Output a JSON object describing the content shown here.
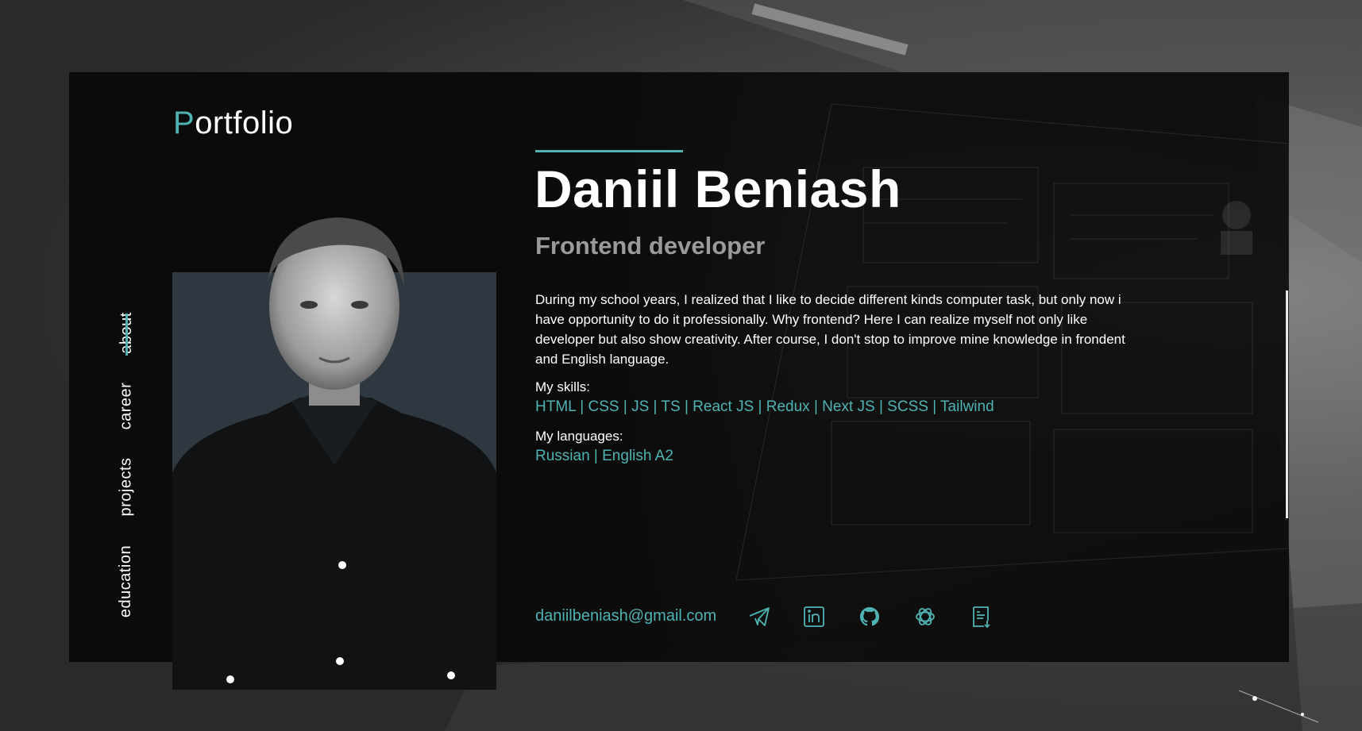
{
  "logo": {
    "accent_letter": "P",
    "rest": "ortfolio"
  },
  "nav": {
    "items": [
      {
        "label": "about"
      },
      {
        "label": "career"
      },
      {
        "label": "projects"
      },
      {
        "label": "education"
      }
    ],
    "active_index": 0
  },
  "profile": {
    "name": "Daniil Beniash",
    "role": "Frontend developer",
    "bio": "During my school years, I realized that I like to decide different kinds computer task, but only now i have opportunity to do it professionally. Why frontend? Here I can realize myself not only like developer but also show creativity. After course, I don't stop to improve mine knowledge in frondent and English language.",
    "skills_label": "My skills:",
    "skills": "HTML | CSS | JS | TS | React JS | Redux | Next JS | SCSS | Tailwind",
    "languages_label": "My languages:",
    "languages": "Russian | English A2"
  },
  "contacts": {
    "email": "daniilbeniash@gmail.com",
    "icons": [
      "telegram-icon",
      "linkedin-icon",
      "github-icon",
      "openai-icon",
      "resume-download-icon"
    ]
  },
  "colors": {
    "accent": "#4fb3b3",
    "card_bg": "#0b0b0b",
    "muted_text": "#9a9a9a",
    "photo_bg": "#2f3740"
  }
}
